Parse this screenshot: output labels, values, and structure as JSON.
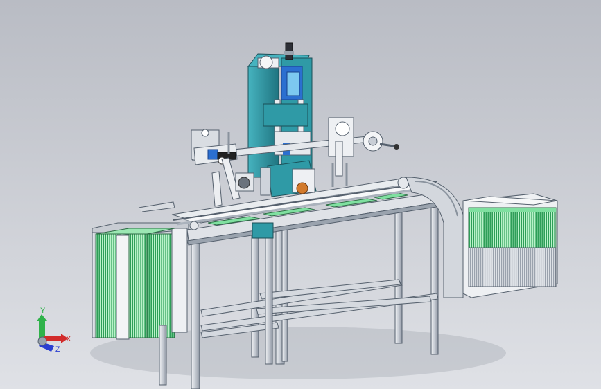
{
  "viewport": {
    "background_top": "#b9bcc4",
    "background_bottom": "#dfe1e6"
  },
  "colors": {
    "machine_teal": "#2f9aa6",
    "machine_teal_dark": "#1f7480",
    "cylinder_blue": "#2b6fd0",
    "frame_gray": "#c9ced6",
    "frame_edge": "#55606d",
    "product_green": "#36b865",
    "product_green_light": "#7fe0a0"
  },
  "triad": {
    "x_label": "X",
    "y_label": "Y",
    "z_label": "Z",
    "x_color": "#d22b2b",
    "y_color": "#2fb24a",
    "z_color": "#2b3fd2"
  }
}
